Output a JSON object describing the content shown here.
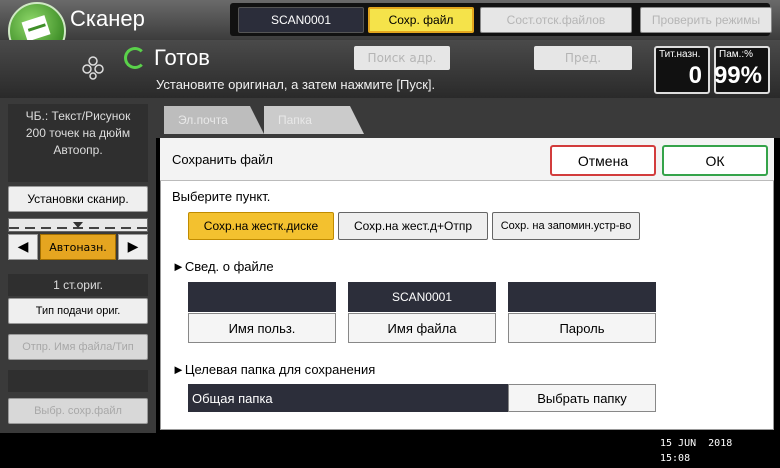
{
  "app": {
    "title": "Сканер",
    "header_buttons": {
      "scan_name": "SCAN0001",
      "save_file": "Сохр. файл",
      "send_status": "Сост.отск.файлов",
      "check_modes": "Проверить режимы"
    }
  },
  "status": {
    "state": "Готов",
    "message": "Установите оригинал, а затем нажмите [Пуск].",
    "search_address": "Поиск адр.",
    "preview": "Пред.",
    "counter_total_label": "Тит.назн.",
    "counter_total_value": "0",
    "memory_label": "Пам.:%",
    "memory_value": "99%"
  },
  "left_panel": {
    "info_line1": "ЧБ.: Текст/Рисунок",
    "info_line2": "200 точек на дюйм",
    "info_line3": "Автоопр.",
    "scan_settings": "Установки сканир.",
    "auto_density": "Автоназн.",
    "orig_count": "1 ст.ориг.",
    "feed_type": "Тип подачи ориг.",
    "send_file_name": "Отпр. Имя файла/Тип",
    "select_folder": "Выбр. сохр.файл"
  },
  "tabs": [
    {
      "label": "Эл.почта"
    },
    {
      "label": "Папка"
    }
  ],
  "dialog": {
    "title": "Сохранить файл",
    "cancel": "Отмена",
    "ok": "ОК",
    "choose_label": "Выберите пункт.",
    "options": [
      "Сохр.на жестк.диске",
      "Сохр.на жест.д+Отпр",
      "Сохр. на запомин.устр-во"
    ],
    "selected_option": 0,
    "file_info_label": "►Свед. о файле",
    "user_name_value": "",
    "file_name_value": "SCAN0001",
    "password_value": "",
    "user_name_btn": "Имя польз.",
    "file_name_btn": "Имя файла",
    "password_btn": "Пароль",
    "target_folder_label": "►Целевая папка для сохранения",
    "folder_value": "Общая папка",
    "select_folder_btn": "Выбрать папку"
  },
  "footer": {
    "date": "15 JUN  2018",
    "time": "15:08"
  },
  "colors": {
    "accent_yellow": "#f3c12f",
    "ok_green": "#35a34a",
    "cancel_red": "#d23c3c",
    "field_dark": "#2c2e3a"
  }
}
